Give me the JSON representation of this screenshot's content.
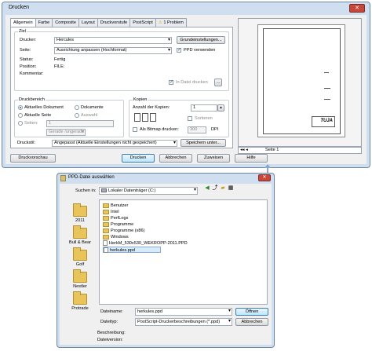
{
  "print_dialog": {
    "title": "Drucken",
    "close": "✕",
    "tabs": [
      "Allgemein",
      "Farbe",
      "Composite",
      "Layout",
      "Druckvorstufe",
      "PostScript",
      "1 Problem"
    ],
    "ziel": {
      "group_label": "Ziel",
      "drucker_label": "Drucker:",
      "drucker_value": "Hercules",
      "grundeinstellungen_button": "Grundeinstellungen...",
      "seite_label": "Seite:",
      "seite_value": "Ausrichtung anpassen (Hochformat)",
      "ppd_checkbox_label": "PPD verwenden",
      "ppd_checked": true,
      "status_label": "Status:",
      "status_value": "Fertig",
      "position_label": "Position:",
      "position_value": "FILE:",
      "kommentar_label": "Kommentar:",
      "in_datei_label": "In Datei drucken",
      "in_datei_checked": true
    },
    "druckbereich": {
      "group_label": "Druckbereich",
      "options": [
        "Aktuelles Dokument",
        "Dokumente",
        "Aktuelle Seite",
        "Auswahl",
        "Seiten:"
      ],
      "pages_value": "1",
      "even_odd_value": "Gerade /ungerade"
    },
    "kopien": {
      "group_label": "Kopien",
      "count_label": "Anzahl der Kopien:",
      "count_value": "1",
      "sortieren_label": "Sortieren",
      "bitmap_label": "Als Bitmap drucken:",
      "dpi_value": "300",
      "dpi_unit": "DPI"
    },
    "druckstil": {
      "label": "Druckstil:",
      "value": "Angepasst (Aktuelle Einstellungen nicht gespeichert)",
      "save_button": "Speichern unter..."
    },
    "preview": {
      "page_selector": "Seite 1",
      "logo_text": "TUJA"
    },
    "buttons": {
      "druckvorschau": "Druckvorschau",
      "drucken": "Drucken",
      "abbrechen": "Abbrechen",
      "zuweisen": "Zuweisen",
      "hilfe": "Hilfe"
    }
  },
  "file_dialog": {
    "title": "PPD-Datei auswählen",
    "close": "✕",
    "suchen_label": "Suchen in:",
    "location": "Lokaler Datenträger (C:)",
    "places": [
      "2011",
      "Bull & Bear",
      "Golf",
      "Nestler",
      "Protrade"
    ],
    "items": [
      {
        "name": "Benutzer",
        "type": "folder"
      },
      {
        "name": "Intel",
        "type": "folder"
      },
      {
        "name": "PerfLogs",
        "type": "folder"
      },
      {
        "name": "Programme",
        "type": "folder"
      },
      {
        "name": "Programme (x86)",
        "type": "folder"
      },
      {
        "name": "Windows",
        "type": "folder"
      },
      {
        "name": "HerkM_530x530_WEKROPP-2011.PPD",
        "type": "file"
      },
      {
        "name": "herkules.ppd",
        "type": "file",
        "selected": true
      }
    ],
    "dateiname_label": "Dateiname:",
    "dateiname_value": "herkules.ppd",
    "dateityp_label": "Dateityp:",
    "dateityp_value": "PostScript-Druckerbeschreibungen (*.ppd)",
    "beschreibung_label": "Beschreibung:",
    "dateiversion_label": "Dateiversion:",
    "oeffnen_button": "Öffnen",
    "abbrechen_button": "Abbrechen"
  }
}
